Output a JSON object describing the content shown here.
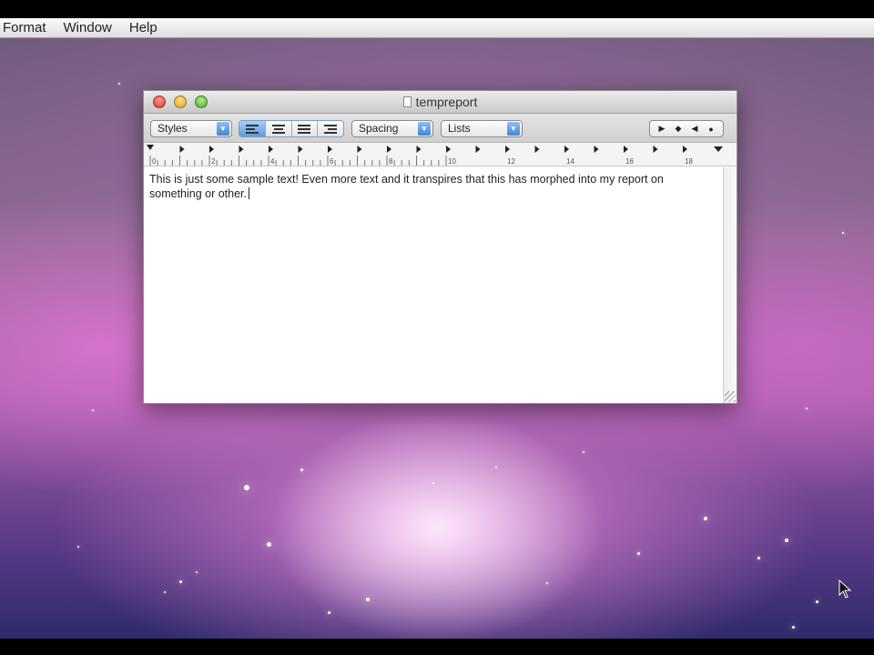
{
  "menubar": {
    "items": [
      "Format",
      "Window",
      "Help"
    ]
  },
  "window": {
    "title": "tempreport",
    "toolbar": {
      "styles_label": "Styles",
      "spacing_label": "Spacing",
      "lists_label": "Lists",
      "alignment_active": "left"
    },
    "ruler": {
      "numbers": [
        "0",
        "2",
        "4",
        "6",
        "8",
        "10",
        "12",
        "14",
        "16",
        "18"
      ]
    },
    "document_text": "This is just some sample text! Even more text and it transpires that this has morphed into my report on something or other."
  },
  "icons": {
    "arrow": "▼",
    "tab_left": "▶",
    "tab_center": "◆",
    "tab_right": "◀",
    "tab_decimal": "●"
  },
  "colors": {
    "accent_blue": "#5d9be0",
    "close": "#d9362b",
    "minimize": "#e2a216",
    "zoom": "#47a52b"
  }
}
